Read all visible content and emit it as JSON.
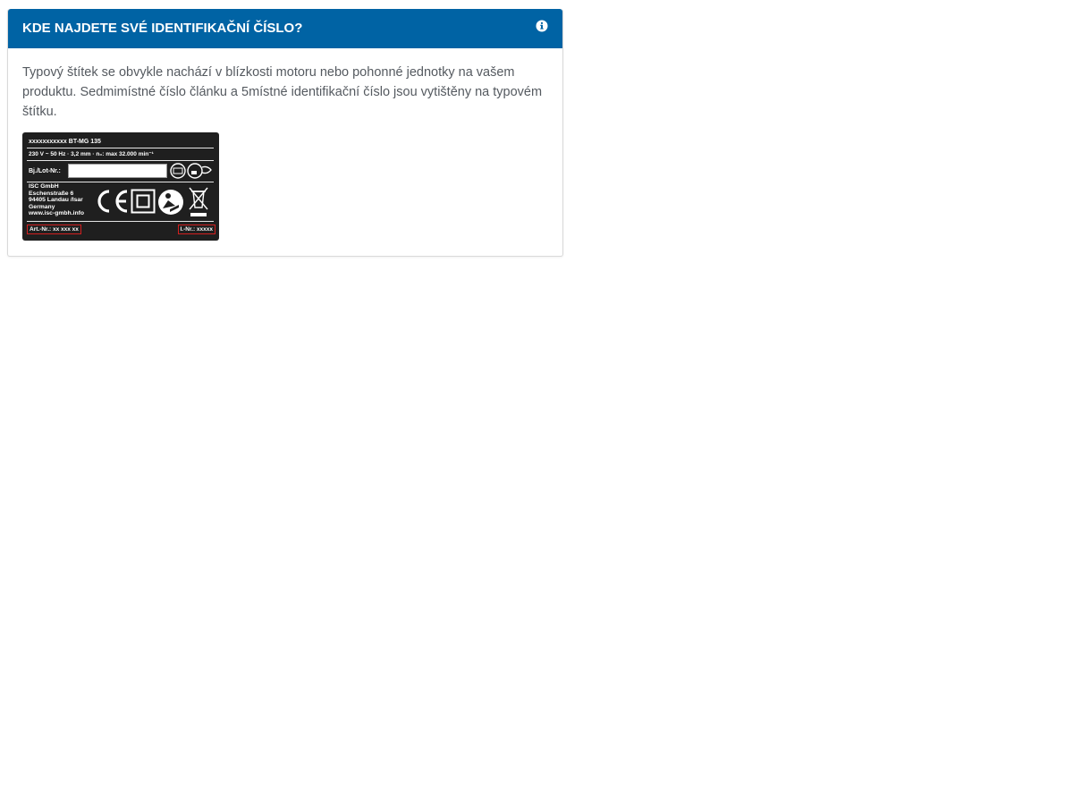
{
  "panel": {
    "title": "KDE NAJDETE SVÉ IDENTIFIKAČNÍ ČÍSLO?",
    "info_icon": "info-circle-icon",
    "text": "Typový štítek se obvykle nachází v blízkosti motoru nebo pohonné jednotky na vašem produktu. Sedmimístné číslo článku a 5místné identifikační číslo jsou vytištěny na typovém štítku."
  },
  "type_plate": {
    "model_line": "xxxxxxxxxxx BT-MG 135",
    "spec_line": "230 V ~ 50 Hz · 3,2 mm · n₀: max 32.000 min⁻¹",
    "lot_label": "Bj./Lot-Nr.:",
    "company_lines": [
      "ISC GmbH",
      "Eschenstraße 6",
      "94405 Landau /Isar",
      "Germany",
      "www.isc-gmbh.info"
    ],
    "article_number": "Art.-Nr.: xx xxx xx",
    "ident_number": "I.-Nr.: xxxxx",
    "symbols": [
      "ce-mark-icon",
      "protection-class-ii-icon",
      "read-manual-icon",
      "weee-bin-icon"
    ]
  },
  "colors": {
    "header_bg": "#0063a4",
    "header_text": "#ffffff",
    "body_text": "#555a60",
    "plate_bg": "#1f1f1f",
    "highlight": "#d21f1f"
  }
}
